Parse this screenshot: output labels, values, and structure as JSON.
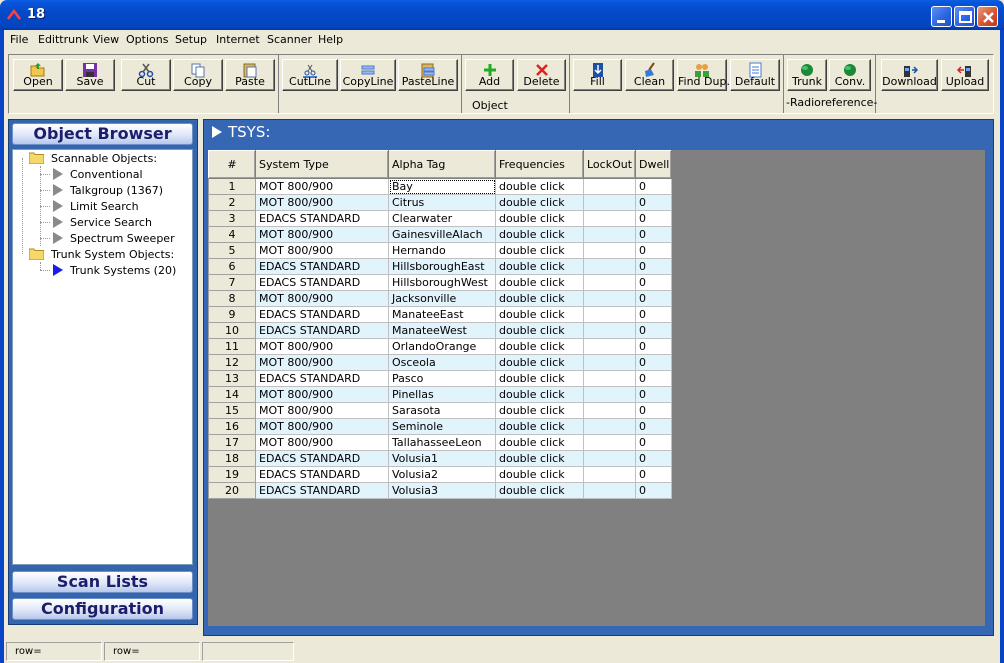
{
  "window": {
    "title": "18"
  },
  "menu": [
    "File",
    "Edittrunk",
    "View",
    "Options",
    "Setup",
    "Internet",
    "Scanner",
    "Help"
  ],
  "toolbar": {
    "open": "Open",
    "save": "Save",
    "cut": "Cut",
    "copy": "Copy",
    "paste": "Paste",
    "cutline": "CutLine",
    "copyline": "CopyLine",
    "pasteline": "PasteLine",
    "add": "Add",
    "delete": "Delete",
    "object_group": "Object",
    "fill": "Fill",
    "clean": "Clean",
    "find_dup": "Find Dup.",
    "default": "Default",
    "trunk": "Trunk",
    "conv": "Conv.",
    "radioreference_group": "-Radioreference-",
    "download": "Download",
    "upload": "Upload"
  },
  "left": {
    "object_browser": "Object Browser",
    "scan_lists": "Scan Lists",
    "configuration": "Configuration",
    "tree": {
      "scannable": "Scannable Objects:",
      "conventional": "Conventional",
      "talkgroup": "Talkgroup (1367)",
      "limit_search": "Limit Search",
      "service_search": "Service Search",
      "spectrum_sweeper": "Spectrum Sweeper",
      "trunk_objects": "Trunk System Objects:",
      "trunk_systems": "Trunk Systems (20)"
    }
  },
  "main": {
    "header": "TSYS:",
    "columns": [
      "#",
      "System Type",
      "Alpha Tag",
      "Frequencies",
      "LockOut",
      "Dwell"
    ],
    "rows": [
      {
        "n": "1",
        "type": "MOT 800/900",
        "tag": "Bay",
        "freq": "double click",
        "lock": "",
        "dwell": "0"
      },
      {
        "n": "2",
        "type": "MOT 800/900",
        "tag": "Citrus",
        "freq": "double click",
        "lock": "",
        "dwell": "0"
      },
      {
        "n": "3",
        "type": "EDACS STANDARD",
        "tag": "Clearwater",
        "freq": "double click",
        "lock": "",
        "dwell": "0"
      },
      {
        "n": "4",
        "type": "MOT 800/900",
        "tag": "GainesvilleAlach",
        "freq": "double click",
        "lock": "",
        "dwell": "0"
      },
      {
        "n": "5",
        "type": "MOT 800/900",
        "tag": "Hernando",
        "freq": "double click",
        "lock": "",
        "dwell": "0"
      },
      {
        "n": "6",
        "type": "EDACS STANDARD",
        "tag": "HillsboroughEast",
        "freq": "double click",
        "lock": "",
        "dwell": "0"
      },
      {
        "n": "7",
        "type": "EDACS STANDARD",
        "tag": "HillsboroughWest",
        "freq": "double click",
        "lock": "",
        "dwell": "0"
      },
      {
        "n": "8",
        "type": "MOT 800/900",
        "tag": "Jacksonville",
        "freq": "double click",
        "lock": "",
        "dwell": "0"
      },
      {
        "n": "9",
        "type": "EDACS STANDARD",
        "tag": "ManateeEast",
        "freq": "double click",
        "lock": "",
        "dwell": "0"
      },
      {
        "n": "10",
        "type": "EDACS STANDARD",
        "tag": "ManateeWest",
        "freq": "double click",
        "lock": "",
        "dwell": "0"
      },
      {
        "n": "11",
        "type": "MOT 800/900",
        "tag": "OrlandoOrange",
        "freq": "double click",
        "lock": "",
        "dwell": "0"
      },
      {
        "n": "12",
        "type": "MOT 800/900",
        "tag": "Osceola",
        "freq": "double click",
        "lock": "",
        "dwell": "0"
      },
      {
        "n": "13",
        "type": "EDACS STANDARD",
        "tag": "Pasco",
        "freq": "double click",
        "lock": "",
        "dwell": "0"
      },
      {
        "n": "14",
        "type": "MOT 800/900",
        "tag": "Pinellas",
        "freq": "double click",
        "lock": "",
        "dwell": "0"
      },
      {
        "n": "15",
        "type": "MOT 800/900",
        "tag": "Sarasota",
        "freq": "double click",
        "lock": "",
        "dwell": "0"
      },
      {
        "n": "16",
        "type": "MOT 800/900",
        "tag": "Seminole",
        "freq": "double click",
        "lock": "",
        "dwell": "0"
      },
      {
        "n": "17",
        "type": "MOT 800/900",
        "tag": "TallahasseeLeon",
        "freq": "double click",
        "lock": "",
        "dwell": "0"
      },
      {
        "n": "18",
        "type": "EDACS STANDARD",
        "tag": "Volusia1",
        "freq": "double click",
        "lock": "",
        "dwell": "0"
      },
      {
        "n": "19",
        "type": "EDACS STANDARD",
        "tag": "Volusia2",
        "freq": "double click",
        "lock": "",
        "dwell": "0"
      },
      {
        "n": "20",
        "type": "EDACS STANDARD",
        "tag": "Volusia3",
        "freq": "double click",
        "lock": "",
        "dwell": "0"
      }
    ]
  },
  "status": {
    "left": "row=",
    "middle": "row="
  },
  "colors": {
    "title_bar": "#0549c9",
    "panel_blue": "#3567b5",
    "row_alt": "#e1f3fb",
    "grid_bg": "#808080"
  }
}
